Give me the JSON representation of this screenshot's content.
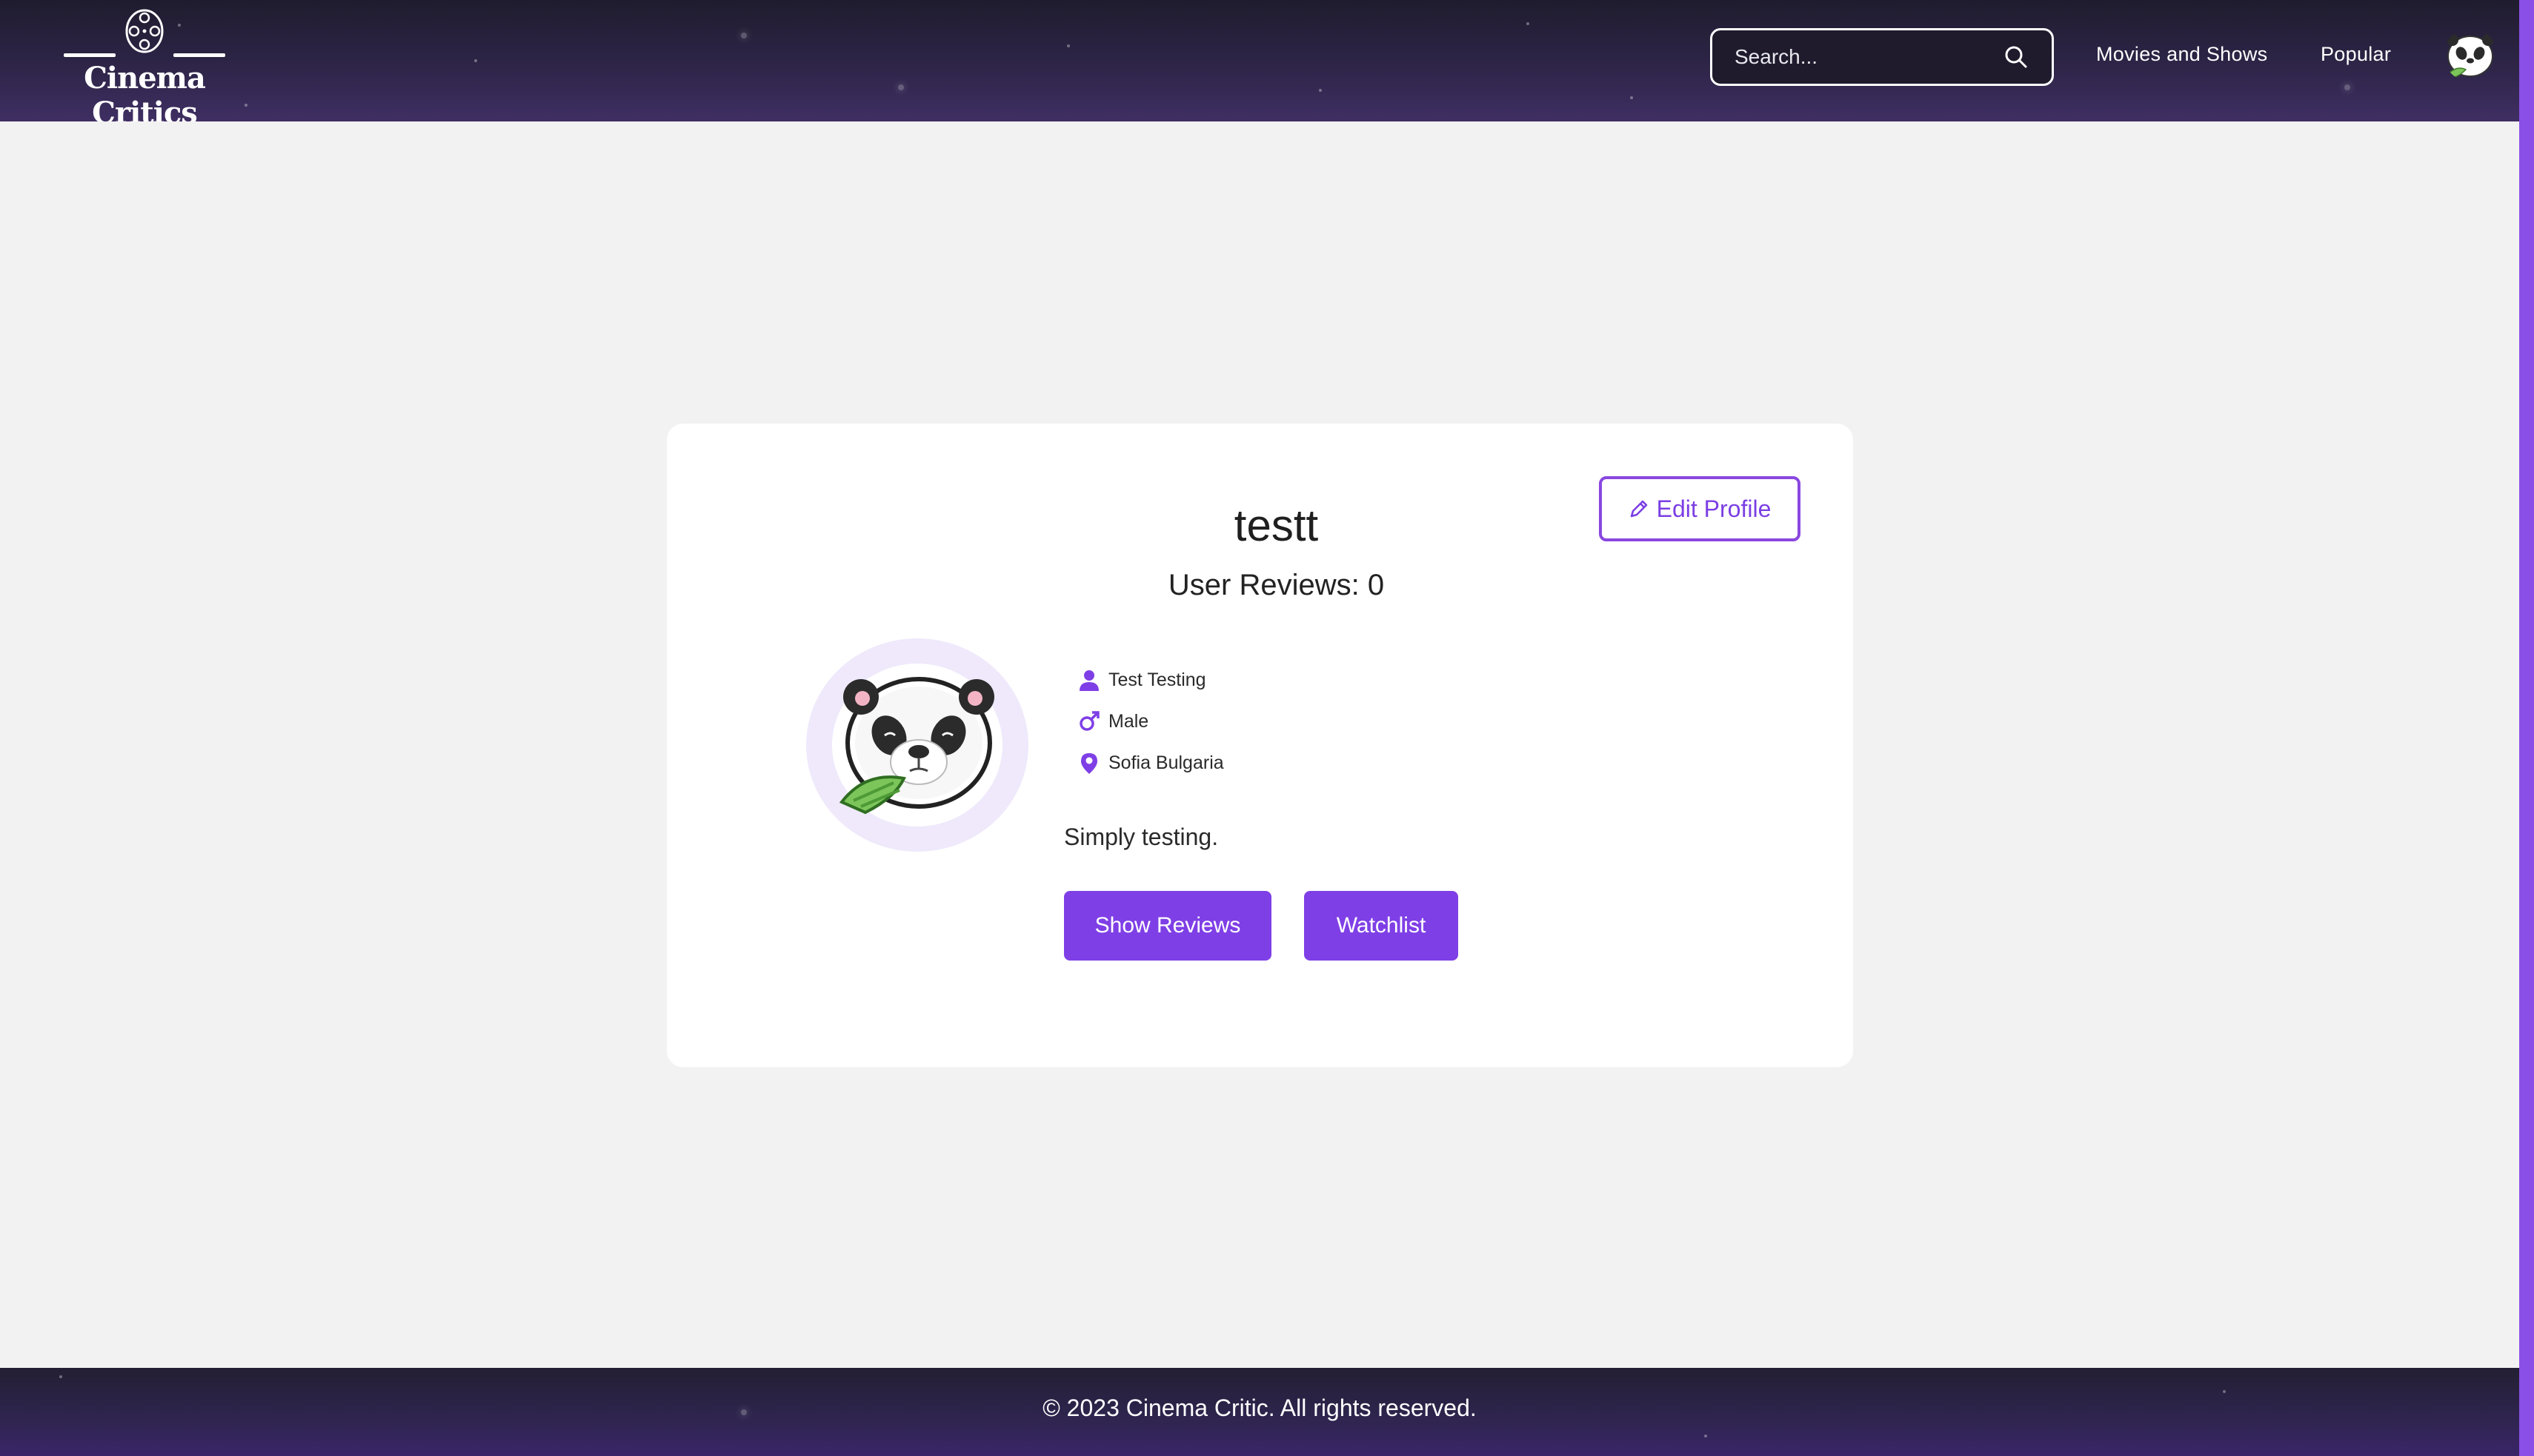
{
  "brand": {
    "name": "Cinema Critics"
  },
  "search": {
    "placeholder": "Search..."
  },
  "nav": {
    "links": [
      {
        "label": "Movies and Shows"
      },
      {
        "label": "Popular"
      }
    ]
  },
  "profile": {
    "edit_label": "Edit Profile",
    "username": "testt",
    "reviews_label": "User Reviews:",
    "reviews_count": "0",
    "full_name": "Test Testing",
    "gender": "Male",
    "location": "Sofia Bulgaria",
    "bio": "Simply testing.",
    "show_reviews_label": "Show Reviews",
    "watchlist_label": "Watchlist"
  },
  "footer": {
    "text": "© 2023 Cinema Critic. All rights reserved."
  },
  "colors": {
    "accent": "#7f3fe6",
    "header_bg": "#2e2548",
    "page_bg": "#f2f2f2",
    "avatar_ring": "#efe9fb"
  }
}
